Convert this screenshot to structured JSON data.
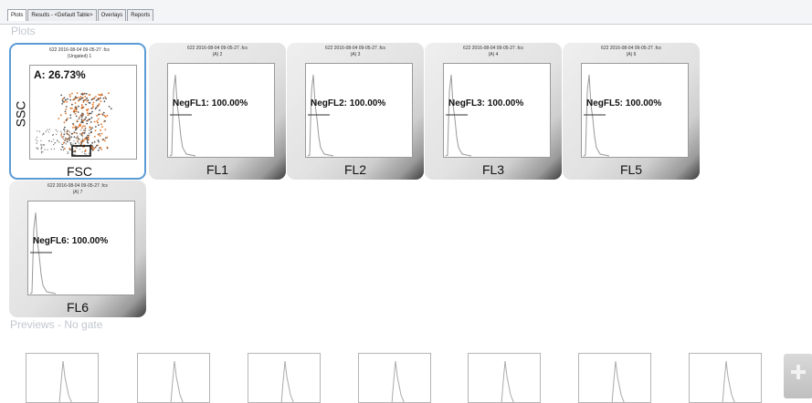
{
  "tabs": [
    "Plots",
    "Results - <Default Table>",
    "Overlays",
    "Reports"
  ],
  "sections": {
    "plots": "Plots",
    "previews": "Previews - No gate"
  },
  "plots": [
    {
      "caption1": "622 2016-08-04 09-05-27 .fcs",
      "caption2": "(Ungated) 1",
      "gate": "A: 26.73%",
      "xlabel": "FSC",
      "ylabel": "SSC",
      "type": "scatter"
    },
    {
      "caption1": "622 2016-08-04 09-05-27 .fcs",
      "caption2": "(A) 2",
      "gate": "NegFL1: 100.00%",
      "xlabel": "FL1",
      "type": "histogram"
    },
    {
      "caption1": "622 2016-08-04 09-05-27 .fcs",
      "caption2": "(A) 3",
      "gate": "NegFL2: 100.00%",
      "xlabel": "FL2",
      "type": "histogram"
    },
    {
      "caption1": "622 2016-08-04 09-05-27 .fcs",
      "caption2": "(A) 4",
      "gate": "NegFL3: 100.00%",
      "xlabel": "FL3",
      "type": "histogram"
    },
    {
      "caption1": "622 2016-08-04 09-05-27 .fcs",
      "caption2": "(A) 6",
      "gate": "NegFL5: 100.00%",
      "xlabel": "FL5",
      "type": "histogram"
    },
    {
      "caption1": "622 2016-08-04 09-05-27 .fcs",
      "caption2": "(A) 7",
      "gate": "NegFL6: 100.00%",
      "xlabel": "FL6",
      "type": "histogram"
    }
  ],
  "previews": 7,
  "colors": {
    "selected_border": "#5b9bd5",
    "scatter_dots": "#e07020",
    "section_title": "#c2c8cf"
  },
  "icons": {
    "scroll": "plus-icon"
  }
}
